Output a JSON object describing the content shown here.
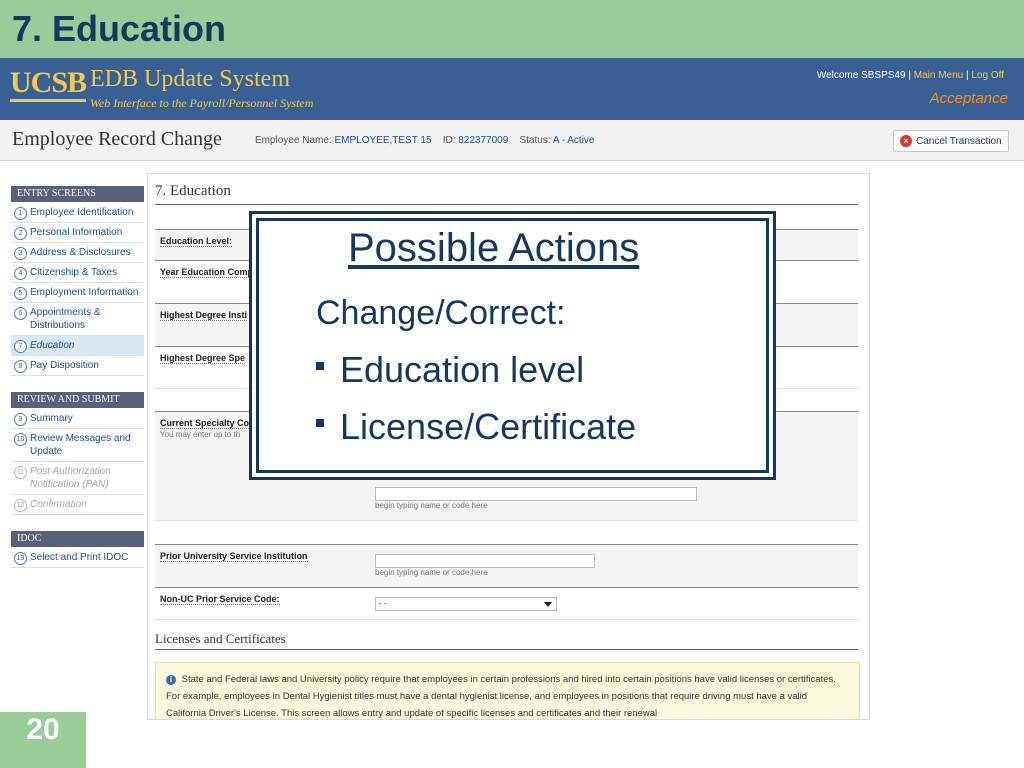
{
  "slide": {
    "title": "7. Education",
    "page_number": "20"
  },
  "header": {
    "logo": "UCSB",
    "system_name": "EDB Update System",
    "system_subtitle": "Web Interface to the Payroll/Personnel System",
    "welcome": "Welcome SBSPS49",
    "main_menu": "Main Menu",
    "log_off": "Log Off",
    "environment": "Acceptance"
  },
  "record": {
    "title": "Employee Record Change",
    "employee_label": "Employee Name:",
    "employee_name": "EMPLOYEE,TEST 15",
    "id_label": "ID:",
    "id": "822377009",
    "status_label": "Status:",
    "status": "A - Active",
    "cancel_label": "Cancel Transaction"
  },
  "sidebar": {
    "entry_heading": "ENTRY SCREENS",
    "entry_items": [
      {
        "num": "1",
        "label": "Employee Identification"
      },
      {
        "num": "2",
        "label": "Personal Information"
      },
      {
        "num": "3",
        "label": "Address & Disclosures"
      },
      {
        "num": "4",
        "label": "Citizenship & Taxes"
      },
      {
        "num": "5",
        "label": "Employment Information"
      },
      {
        "num": "6",
        "label": "Appointments & Distributions"
      },
      {
        "num": "7",
        "label": "Education"
      },
      {
        "num": "8",
        "label": "Pay Disposition"
      }
    ],
    "review_heading": "REVIEW AND SUBMIT",
    "review_items": [
      {
        "num": "9",
        "label": "Summary"
      },
      {
        "num": "10",
        "label": "Review Messages and Update"
      },
      {
        "num": "11",
        "label": "Post Authorization Notification (PAN)"
      },
      {
        "num": "12",
        "label": "Confirmation"
      }
    ],
    "idoc_heading": "IDOC",
    "idoc_items": [
      {
        "num": "13",
        "label": "Select and Print IDOC"
      }
    ]
  },
  "form": {
    "section_title": "7. Education",
    "education_level_label": "Education Level:",
    "year_completed_label": "Year Education Comp",
    "highest_degree_inst_label": "Highest Degree Insti",
    "highest_degree_spec_label": "Highest Degree Spe",
    "current_specialty_label": "Current Specialty Co",
    "current_specialty_note": "You may enter up to th",
    "specialty_hint": "begin typing name or code here",
    "prior_service_label": "Prior University Service Institution",
    "prior_service_hint": "begin typing name or code here",
    "non_uc_label": "Non-UC Prior Service Code:",
    "non_uc_value": "- -",
    "licenses_title": "Licenses and Certificates",
    "notice_text": "State and Federal laws and University policy require that employees in certain professions and hired into certain positions have valid licenses or certificates. For example, employees in Dental Hygienist titles must have a dental hygienist license, and employees in positions that require driving must have a valid California Driver's License. This screen allows entry and update of specific licenses and certificates and their renewal"
  },
  "popup": {
    "heading": "Possible Actions",
    "subheading": "Change/Correct:",
    "bullets": [
      "Education level",
      "License/Certificate"
    ]
  }
}
